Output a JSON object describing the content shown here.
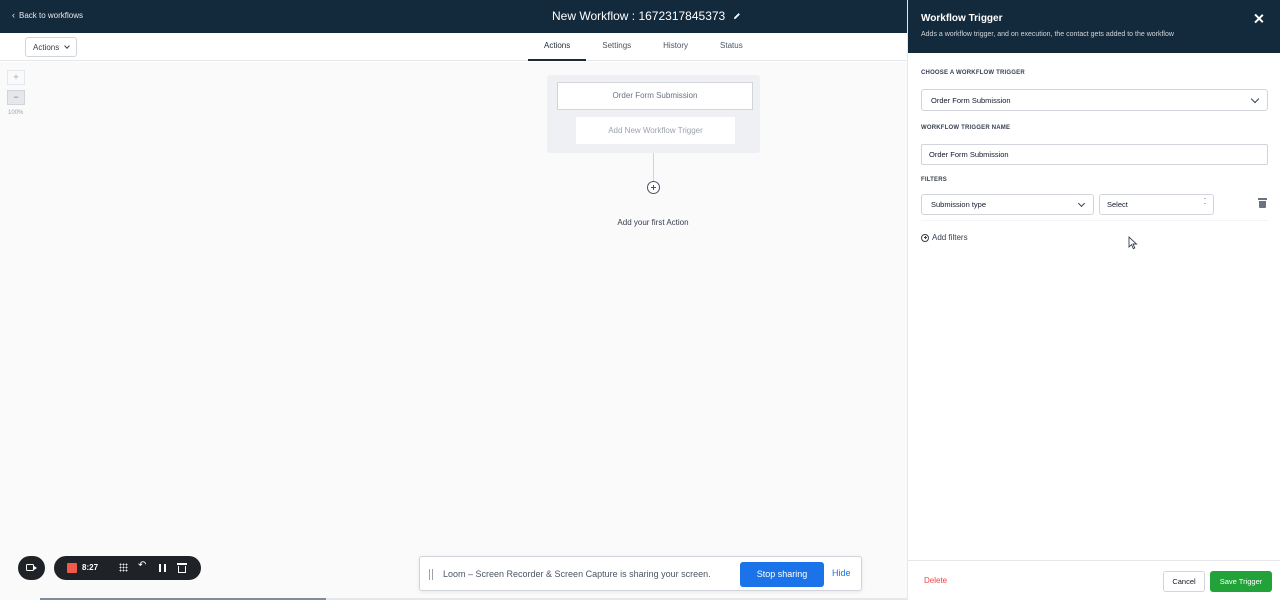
{
  "topbar": {
    "back_label": "Back to workflows",
    "workflow_title": "New Workflow : 1672317845373"
  },
  "subbar": {
    "actions_label": "Actions",
    "tabs": [
      {
        "label": "Actions",
        "active": true
      },
      {
        "label": "Settings",
        "active": false
      },
      {
        "label": "History",
        "active": false
      },
      {
        "label": "Status",
        "active": false
      }
    ]
  },
  "canvas": {
    "zoom_in": "+",
    "zoom_out": "−",
    "zoom_level": "100%",
    "trigger_card": "Order Form Submission",
    "add_trigger": "Add New Workflow Trigger",
    "first_action": "Add your first Action"
  },
  "panel": {
    "title": "Workflow Trigger",
    "description": "Adds a workflow trigger, and on execution, the contact gets added to the workflow",
    "choose_label": "CHOOSE A WORKFLOW TRIGGER",
    "choose_value": "Order Form Submission",
    "name_label": "WORKFLOW TRIGGER NAME",
    "name_value": "Order Form Submission",
    "filters_label": "FILTERS",
    "filter_field": "Submission type",
    "filter_value": "Select",
    "add_filters": "Add filters",
    "delete_label": "Delete",
    "cancel_label": "Cancel",
    "save_label": "Save Trigger"
  },
  "recorder": {
    "time": "8:27",
    "share_message": "Loom – Screen Recorder & Screen Capture is sharing your screen.",
    "stop_label": "Stop sharing",
    "hide_label": "Hide"
  },
  "colors": {
    "header_bg": "#132a3d",
    "save_green": "#22a33a",
    "delete_red": "#ef4444",
    "share_blue": "#1a73e8",
    "record_red": "#f15a4a"
  }
}
